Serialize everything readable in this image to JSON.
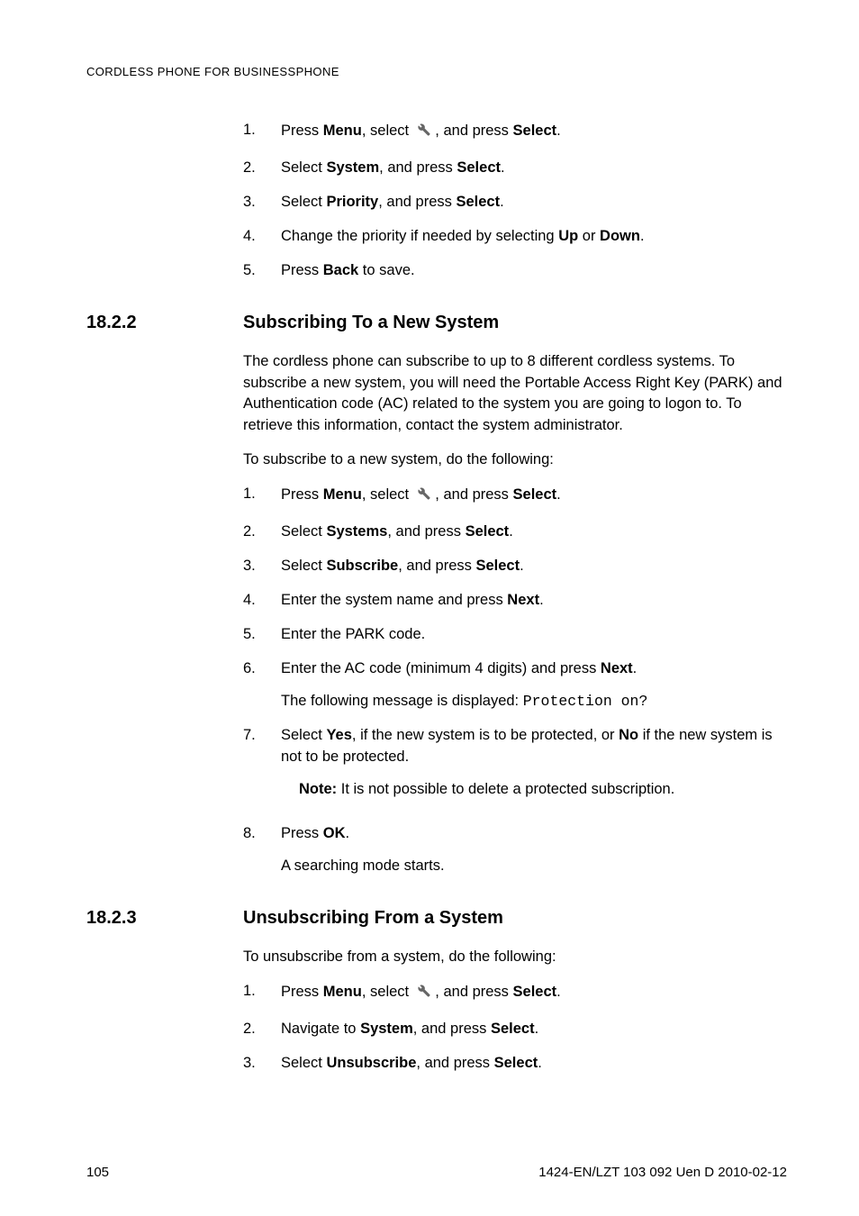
{
  "header": "CORDLESS PHONE FOR BUSINESSPHONE",
  "icon_name": "settings-wrench-icon",
  "top_list": [
    {
      "pre": "Press ",
      "b1": "Menu",
      "mid1": ", select ",
      "icon": true,
      "mid2": ", and press ",
      "b2": "Select",
      "post": "."
    },
    {
      "pre": "Select ",
      "b1": "System",
      "mid1": ", and press ",
      "b2": "Select",
      "post": "."
    },
    {
      "pre": "Select ",
      "b1": "Priority",
      "mid1": ", and press ",
      "b2": "Select",
      "post": "."
    },
    {
      "pre": "Change the priority if needed by selecting ",
      "b1": "Up",
      "mid1": " or ",
      "b2": "Down",
      "post": "."
    },
    {
      "pre": "Press ",
      "b1": "Back",
      "post": " to save."
    }
  ],
  "sec1": {
    "num": "18.2.2",
    "title": "Subscribing To a New System"
  },
  "sec1_para": "The cordless phone can subscribe to up to 8 different cordless systems. To subscribe a new system, you will need the Portable Access Right Key (PARK) and Authentication code (AC) related to the system you are going to logon to. To retrieve this information, contact the system administrator.",
  "sec1_lead": "To subscribe to a new system, do the following:",
  "sec1_list": [
    {
      "pre": "Press ",
      "b1": "Menu",
      "mid1": ", select ",
      "icon": true,
      "mid2": ", and press ",
      "b2": "Select",
      "post": "."
    },
    {
      "pre": "Select ",
      "b1": "Systems",
      "mid1": ", and press ",
      "b2": "Select",
      "post": "."
    },
    {
      "pre": "Select ",
      "b1": "Subscribe",
      "mid1": ", and press ",
      "b2": "Select",
      "post": "."
    },
    {
      "pre": "Enter the system name and press ",
      "b1": "Next",
      "post": "."
    },
    {
      "pre": "Enter the PARK code."
    },
    {
      "pre": "Enter the AC code (minimum 4 digits) and press ",
      "b1": "Next",
      "post": ".",
      "extra_plain": "The following message is displayed: ",
      "extra_code": "Protection on?"
    },
    {
      "pre": "Select ",
      "b1": "Yes",
      "mid1": ", if the new system is to be protected, or ",
      "b2": "No",
      "post": " if the new system is not to be protected.",
      "note_b": "Note:",
      "note_t": "  It is not possible to delete a protected subscription."
    },
    {
      "pre": "Press ",
      "b1": "OK",
      "post": ".",
      "extra_plain": "A searching mode starts."
    }
  ],
  "sec2": {
    "num": "18.2.3",
    "title": "Unsubscribing From a System"
  },
  "sec2_lead": "To unsubscribe from a system, do the following:",
  "sec2_list": [
    {
      "pre": "Press ",
      "b1": "Menu",
      "mid1": ", select ",
      "icon": true,
      "mid2": ", and press ",
      "b2": "Select",
      "post": "."
    },
    {
      "pre": "Navigate to ",
      "b1": "System",
      "mid1": ", and press ",
      "b2": "Select",
      "post": "."
    },
    {
      "pre": "Select ",
      "b1": "Unsubscribe",
      "mid1": ", and press ",
      "b2": "Select",
      "post": "."
    }
  ],
  "footer": {
    "left": "105",
    "right": "1424-EN/LZT 103 092 Uen D 2010-02-12"
  }
}
